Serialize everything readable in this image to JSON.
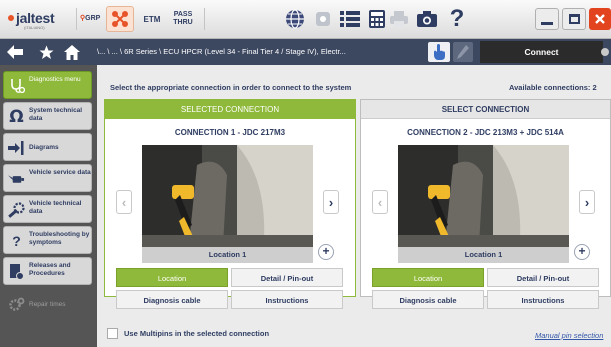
{
  "app": {
    "logo_text": "jaltest",
    "logo_sub": "(ITALIANO)",
    "grp_label": "GRP",
    "etm_label": "ETM",
    "pass_line1": "PASS",
    "pass_line2": "THRU"
  },
  "nav": {
    "breadcrumb": "\\... \\ ... \\ 6R Series \\ ECU HPCR (Level 34 - Final Tier 4 / Stage IV), Electr...",
    "connect_label": "Connect"
  },
  "sidebar": {
    "items": [
      {
        "label": "Diagnostics menu",
        "icon": "stethoscope-icon"
      },
      {
        "label": "System technical data",
        "icon": "ohm-icon"
      },
      {
        "label": "Diagrams",
        "icon": "diagram-arrow-icon"
      },
      {
        "label": "Vehicle service data",
        "icon": "oil-can-icon"
      },
      {
        "label": "Vehicle technical data",
        "icon": "wrench-gear-icon"
      },
      {
        "label": "Troubleshooting by symptoms",
        "icon": "question-gear-icon"
      },
      {
        "label": "Releases and Procedures",
        "icon": "document-gear-icon"
      },
      {
        "label": "Repair times",
        "icon": "repair-gears-icon"
      }
    ]
  },
  "main": {
    "instruction": "Select the appropriate connection in order to connect to the system",
    "available": "Available connections: 2",
    "panels": [
      {
        "header": "SELECTED CONNECTION",
        "title": "CONNECTION 1 - JDC 217M3",
        "location": "Location 1",
        "buttons": [
          "Location",
          "Detail / Pin-out",
          "Diagnosis cable",
          "Instructions"
        ]
      },
      {
        "header": "SELECT CONNECTION",
        "title": "CONNECTION 2 - JDC 213M3 + JDC 514A",
        "location": "Location 1",
        "buttons": [
          "Location",
          "Detail / Pin-out",
          "Diagnosis cable",
          "Instructions"
        ]
      }
    ],
    "multipins_label": "Use Multipins in the selected connection",
    "manual_link": "Manual pin selection"
  },
  "colors": {
    "accent_green": "#8fb93a",
    "navy": "#2f3d62",
    "close_red": "#e1441f"
  }
}
